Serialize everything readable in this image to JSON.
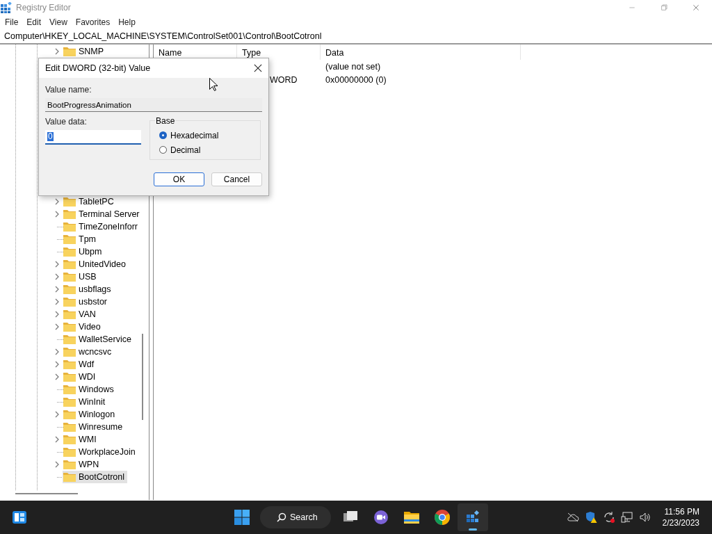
{
  "window": {
    "title": "Registry Editor"
  },
  "menu": [
    "File",
    "Edit",
    "View",
    "Favorites",
    "Help"
  ],
  "address": "Computer\\HKEY_LOCAL_MACHINE\\SYSTEM\\ControlSet001\\Control\\BootCotronl",
  "tree": {
    "items": [
      {
        "label": "SNMP",
        "expandable": true,
        "selected": false
      },
      {
        "label": "TabletPC",
        "expandable": true,
        "selected": false
      },
      {
        "label": "Terminal Server",
        "expandable": true,
        "selected": false
      },
      {
        "label": "TimeZoneInforr",
        "expandable": false,
        "selected": false
      },
      {
        "label": "Tpm",
        "expandable": false,
        "selected": false
      },
      {
        "label": "Ubpm",
        "expandable": false,
        "selected": false
      },
      {
        "label": "UnitedVideo",
        "expandable": true,
        "selected": false
      },
      {
        "label": "USB",
        "expandable": true,
        "selected": false
      },
      {
        "label": "usbflags",
        "expandable": true,
        "selected": false
      },
      {
        "label": "usbstor",
        "expandable": true,
        "selected": false
      },
      {
        "label": "VAN",
        "expandable": true,
        "selected": false
      },
      {
        "label": "Video",
        "expandable": true,
        "selected": false
      },
      {
        "label": "WalletService",
        "expandable": false,
        "selected": false
      },
      {
        "label": "wcncsvc",
        "expandable": true,
        "selected": false
      },
      {
        "label": "Wdf",
        "expandable": true,
        "selected": false
      },
      {
        "label": "WDI",
        "expandable": true,
        "selected": false
      },
      {
        "label": "Windows",
        "expandable": false,
        "selected": false
      },
      {
        "label": "WinInit",
        "expandable": false,
        "selected": false
      },
      {
        "label": "Winlogon",
        "expandable": true,
        "selected": false
      },
      {
        "label": "Winresume",
        "expandable": false,
        "selected": false
      },
      {
        "label": "WMI",
        "expandable": true,
        "selected": false
      },
      {
        "label": "WorkplaceJoin",
        "expandable": false,
        "selected": false
      },
      {
        "label": "WPN",
        "expandable": true,
        "selected": false
      },
      {
        "label": "BootCotronl",
        "expandable": false,
        "selected": true
      }
    ]
  },
  "list": {
    "columns": [
      "Name",
      "Type",
      "Data"
    ],
    "rows": [
      {
        "data": "(value not set)"
      },
      {
        "type": "WORD",
        "data": "0x00000000 (0)"
      }
    ]
  },
  "dialog": {
    "title": "Edit DWORD (32-bit) Value",
    "value_name_label": "Value name:",
    "value_name": "BootProgressAnimation",
    "value_data_label": "Value data:",
    "value_data": "0",
    "base": {
      "title": "Base",
      "options": [
        {
          "label": "Hexadecimal",
          "selected": true
        },
        {
          "label": "Decimal",
          "selected": false
        }
      ]
    },
    "buttons": [
      {
        "label": "OK",
        "default": true
      },
      {
        "label": "Cancel",
        "default": false
      }
    ]
  },
  "taskbar": {
    "search_label": "Search",
    "apps": [
      {
        "kind": "taskview",
        "active": false
      },
      {
        "kind": "chat",
        "active": false
      },
      {
        "kind": "files",
        "active": false
      },
      {
        "kind": "browser",
        "active": false
      },
      {
        "kind": "registry",
        "active": true
      }
    ],
    "time": "11:56 PM",
    "date": "2/23/2023"
  }
}
